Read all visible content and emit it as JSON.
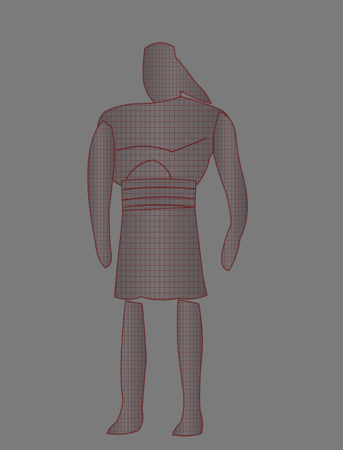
{
  "viewport": {
    "background": "#7b7b7b",
    "mesh_fill": "#6e6869",
    "mesh_shadow": "#5d5859",
    "wire_color": "#6b1f1f",
    "subject": "wireframe-character-model"
  }
}
